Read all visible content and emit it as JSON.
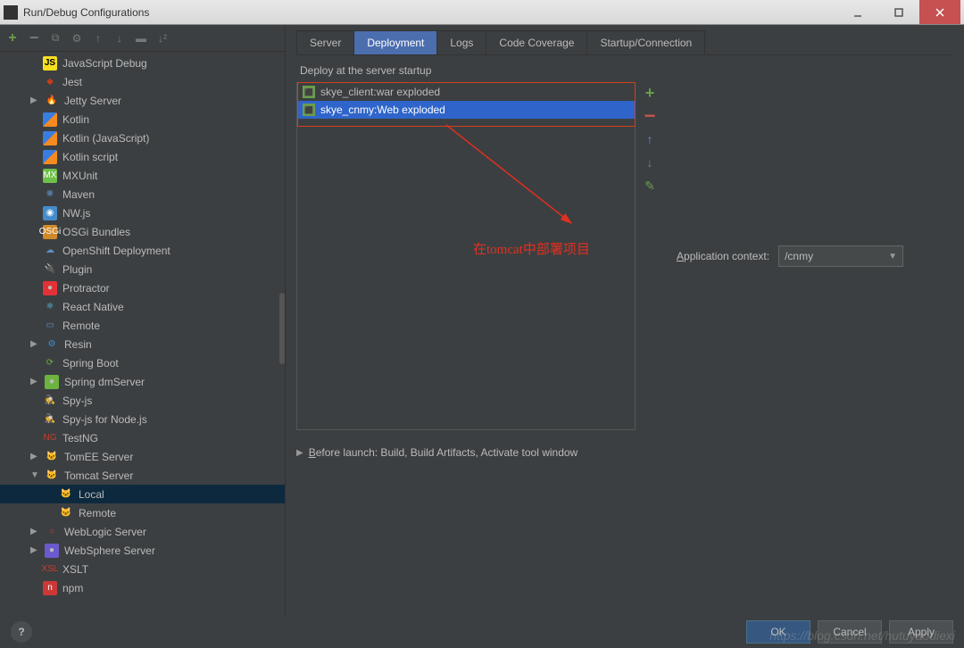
{
  "window": {
    "title": "Run/Debug Configurations"
  },
  "tree": {
    "items": [
      {
        "label": "JavaScript Debug",
        "icon": "ico-js",
        "glyph": "JS",
        "indent": 1
      },
      {
        "label": "Jest",
        "icon": "ico-jest",
        "glyph": "◆",
        "indent": 1
      },
      {
        "label": "Jetty Server",
        "icon": "ico-jetty",
        "glyph": "🔥",
        "indent": 1,
        "expandable": true
      },
      {
        "label": "Kotlin",
        "icon": "ico-kotlin",
        "glyph": "",
        "indent": 1
      },
      {
        "label": "Kotlin (JavaScript)",
        "icon": "ico-kotlin",
        "glyph": "",
        "indent": 1
      },
      {
        "label": "Kotlin script",
        "icon": "ico-kotlin",
        "glyph": "",
        "indent": 1
      },
      {
        "label": "MXUnit",
        "icon": "ico-mxunit",
        "glyph": "MX",
        "indent": 1
      },
      {
        "label": "Maven",
        "icon": "ico-maven",
        "glyph": "❋",
        "indent": 1
      },
      {
        "label": "NW.js",
        "icon": "ico-nw",
        "glyph": "◉",
        "indent": 1
      },
      {
        "label": "OSGi Bundles",
        "icon": "ico-osgi",
        "glyph": "OSGi",
        "indent": 1
      },
      {
        "label": "OpenShift Deployment",
        "icon": "ico-openshift",
        "glyph": "☁",
        "indent": 1
      },
      {
        "label": "Plugin",
        "icon": "ico-plugin",
        "glyph": "🔌",
        "indent": 1
      },
      {
        "label": "Protractor",
        "icon": "ico-protractor",
        "glyph": "●",
        "indent": 1
      },
      {
        "label": "React Native",
        "icon": "ico-react",
        "glyph": "⚛",
        "indent": 1
      },
      {
        "label": "Remote",
        "icon": "ico-remote",
        "glyph": "▭",
        "indent": 1
      },
      {
        "label": "Resin",
        "icon": "ico-resin",
        "glyph": "⚙",
        "indent": 1,
        "expandable": true
      },
      {
        "label": "Spring Boot",
        "icon": "ico-springboot",
        "glyph": "⟳",
        "indent": 1
      },
      {
        "label": "Spring dmServer",
        "icon": "ico-springdm",
        "glyph": "●",
        "indent": 1,
        "expandable": true
      },
      {
        "label": "Spy-js",
        "icon": "ico-spy",
        "glyph": "🕵",
        "indent": 1
      },
      {
        "label": "Spy-js for Node.js",
        "icon": "ico-spy",
        "glyph": "🕵",
        "indent": 1
      },
      {
        "label": "TestNG",
        "icon": "ico-testng",
        "glyph": "NG",
        "indent": 1
      },
      {
        "label": "TomEE Server",
        "icon": "ico-tomee",
        "glyph": "🐱",
        "indent": 1,
        "expandable": true
      },
      {
        "label": "Tomcat Server",
        "icon": "ico-tomcat",
        "glyph": "🐱",
        "indent": 1,
        "expandable": true,
        "expanded": true
      },
      {
        "label": "Local",
        "icon": "ico-tomcat",
        "glyph": "🐱",
        "indent": 2,
        "selected": true
      },
      {
        "label": "Remote",
        "icon": "ico-tomcat",
        "glyph": "🐱",
        "indent": 2
      },
      {
        "label": "WebLogic Server",
        "icon": "ico-weblogic",
        "glyph": "○",
        "indent": 1,
        "expandable": true
      },
      {
        "label": "WebSphere Server",
        "icon": "ico-websphere",
        "glyph": "●",
        "indent": 1,
        "expandable": true
      },
      {
        "label": "XSLT",
        "icon": "ico-xslt",
        "glyph": "XSL",
        "indent": 1
      },
      {
        "label": "npm",
        "icon": "ico-npm",
        "glyph": "n",
        "indent": 1
      }
    ]
  },
  "tabs": [
    {
      "label": "Server"
    },
    {
      "label": "Deployment",
      "active": true
    },
    {
      "label": "Logs"
    },
    {
      "label": "Code Coverage"
    },
    {
      "label": "Startup/Connection"
    }
  ],
  "deploy": {
    "title": "Deploy at the server startup",
    "items": [
      {
        "label": "skye_client:war exploded"
      },
      {
        "label": "skye_cnmy:Web exploded",
        "selected": true
      }
    ]
  },
  "appContext": {
    "label_pre": "A",
    "label_rest": "pplication context:",
    "value": "/cnmy"
  },
  "beforeLaunch": {
    "label_pre": "B",
    "label_rest": "efore launch: Build, Build Artifacts, Activate tool window"
  },
  "buttons": {
    "ok": "OK",
    "cancel": "Cancel",
    "apply": "Apply"
  },
  "annotation": {
    "text": "在tomcat中部署项目"
  },
  "watermark": "https://blog.csdn.net/hutuyaodiexi"
}
